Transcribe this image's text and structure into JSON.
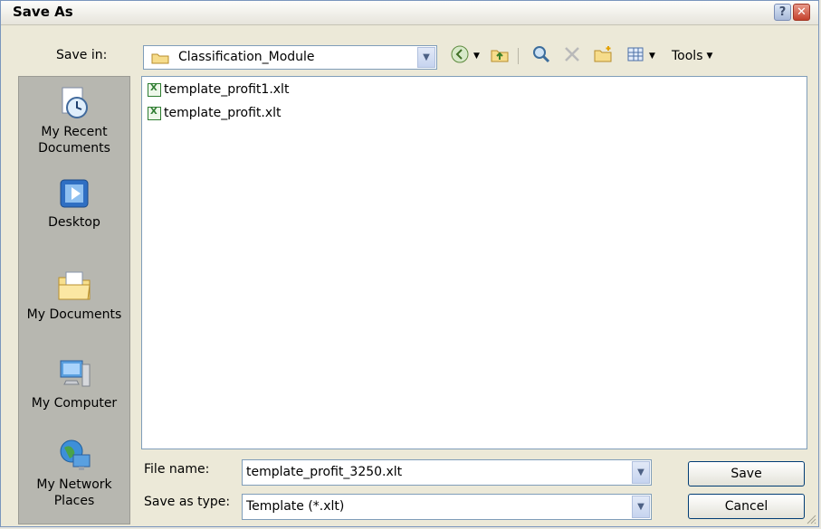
{
  "window": {
    "title": "Save As"
  },
  "titlebar": {
    "help_label": "?",
    "close_label": "✕"
  },
  "save_in": {
    "label": "Save in:",
    "value": "Classification_Module"
  },
  "toolbar": {
    "tools_label": "Tools"
  },
  "places": [
    {
      "label": "My Recent Documents",
      "icon": "recent-documents-icon"
    },
    {
      "label": "Desktop",
      "icon": "desktop-icon"
    },
    {
      "label": "My Documents",
      "icon": "my-documents-icon"
    },
    {
      "label": "My Computer",
      "icon": "my-computer-icon"
    },
    {
      "label": "My Network Places",
      "icon": "network-places-icon"
    }
  ],
  "files": [
    {
      "name": "template_profit1.xlt",
      "icon": "excel-template-icon"
    },
    {
      "name": "template_profit.xlt",
      "icon": "excel-template-icon"
    }
  ],
  "file_name": {
    "label": "File name:",
    "value": "template_profit_3250.xlt"
  },
  "save_as_type": {
    "label": "Save as type:",
    "value": "Template (*.xlt)"
  },
  "buttons": {
    "save": "Save",
    "cancel": "Cancel"
  },
  "colors": {
    "window_bg": "#ece9d8",
    "places_bg": "#b7b7b0",
    "border": "#7f9db9",
    "excel_green": "#2f7d32"
  }
}
